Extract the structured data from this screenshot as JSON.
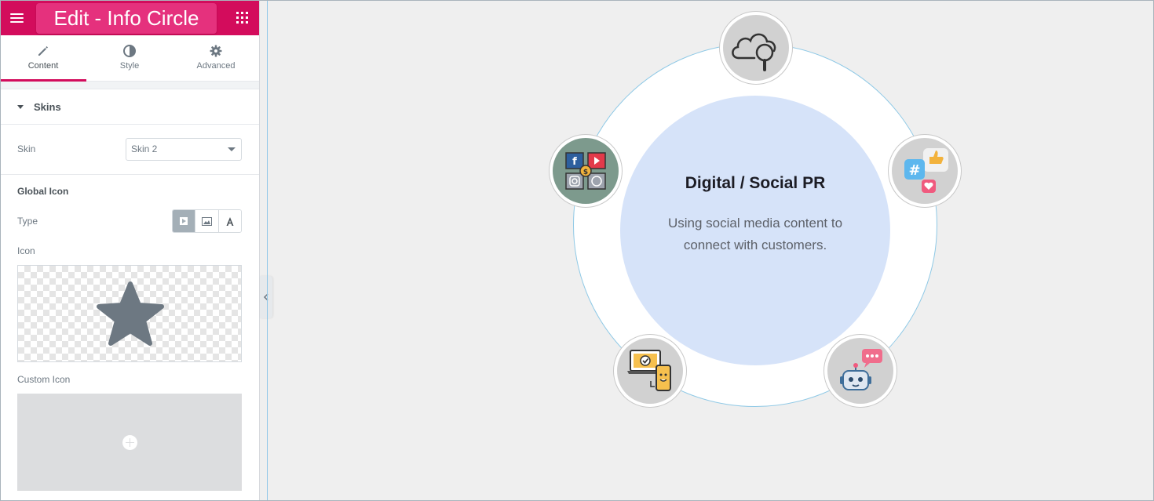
{
  "panel": {
    "title": "Edit - Info Circle",
    "tabs": [
      {
        "label": "Content",
        "icon": "pencil-icon"
      },
      {
        "label": "Style",
        "icon": "half-circle-icon"
      },
      {
        "label": "Advanced",
        "icon": "gear-icon"
      }
    ],
    "section_title": "Skins",
    "skin_label": "Skin",
    "skin_value": "Skin 2",
    "global_icon_heading": "Global Icon",
    "type_label": "Type",
    "icon_label": "Icon",
    "custom_icon_label": "Custom Icon",
    "accent": "#d30c5c"
  },
  "preview": {
    "title": "Digital / Social PR",
    "description": "Using social media content to connect with customers.",
    "items": [
      {
        "icon": "cloud-search-icon"
      },
      {
        "icon": "social-hashtag-like-icon"
      },
      {
        "icon": "chatbot-icon"
      },
      {
        "icon": "laptop-phone-icon"
      },
      {
        "icon": "social-media-grid-icon",
        "active": true
      }
    ]
  }
}
